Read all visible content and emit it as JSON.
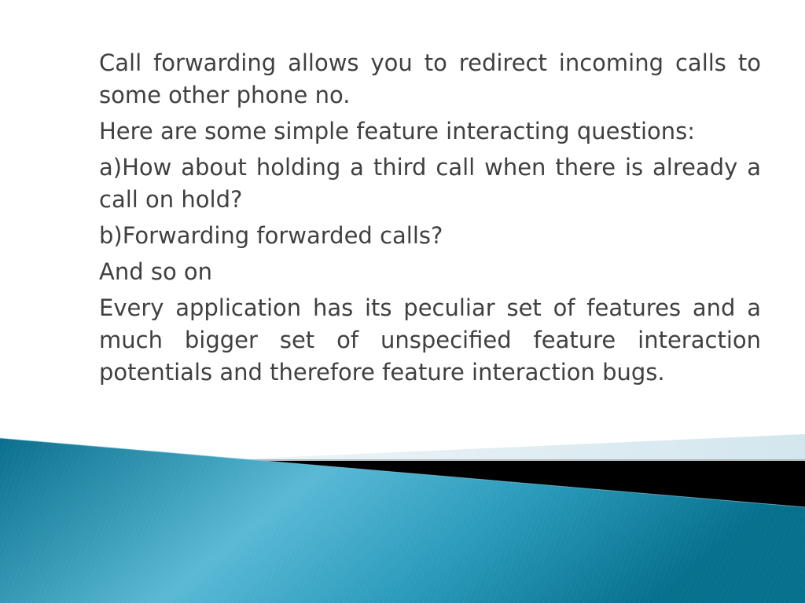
{
  "slide": {
    "paragraphs": [
      "Call forwarding allows you to redirect incoming calls to some other phone no.",
      "Here are some simple feature interacting questions:",
      "a)How about holding a third call when there is already a call on hold?",
      "b)Forwarding forwarded calls?",
      "And so on",
      "Every application has its peculiar set of features and a much bigger set of unspecified feature interaction potentials and therefore feature interaction bugs."
    ]
  },
  "theme": {
    "text_color": "#404040",
    "accent_teal_dark": "#0a7391",
    "accent_teal_light": "#5bbcd8",
    "band_light": "#d6e8ef",
    "band_dark": "#000000"
  }
}
